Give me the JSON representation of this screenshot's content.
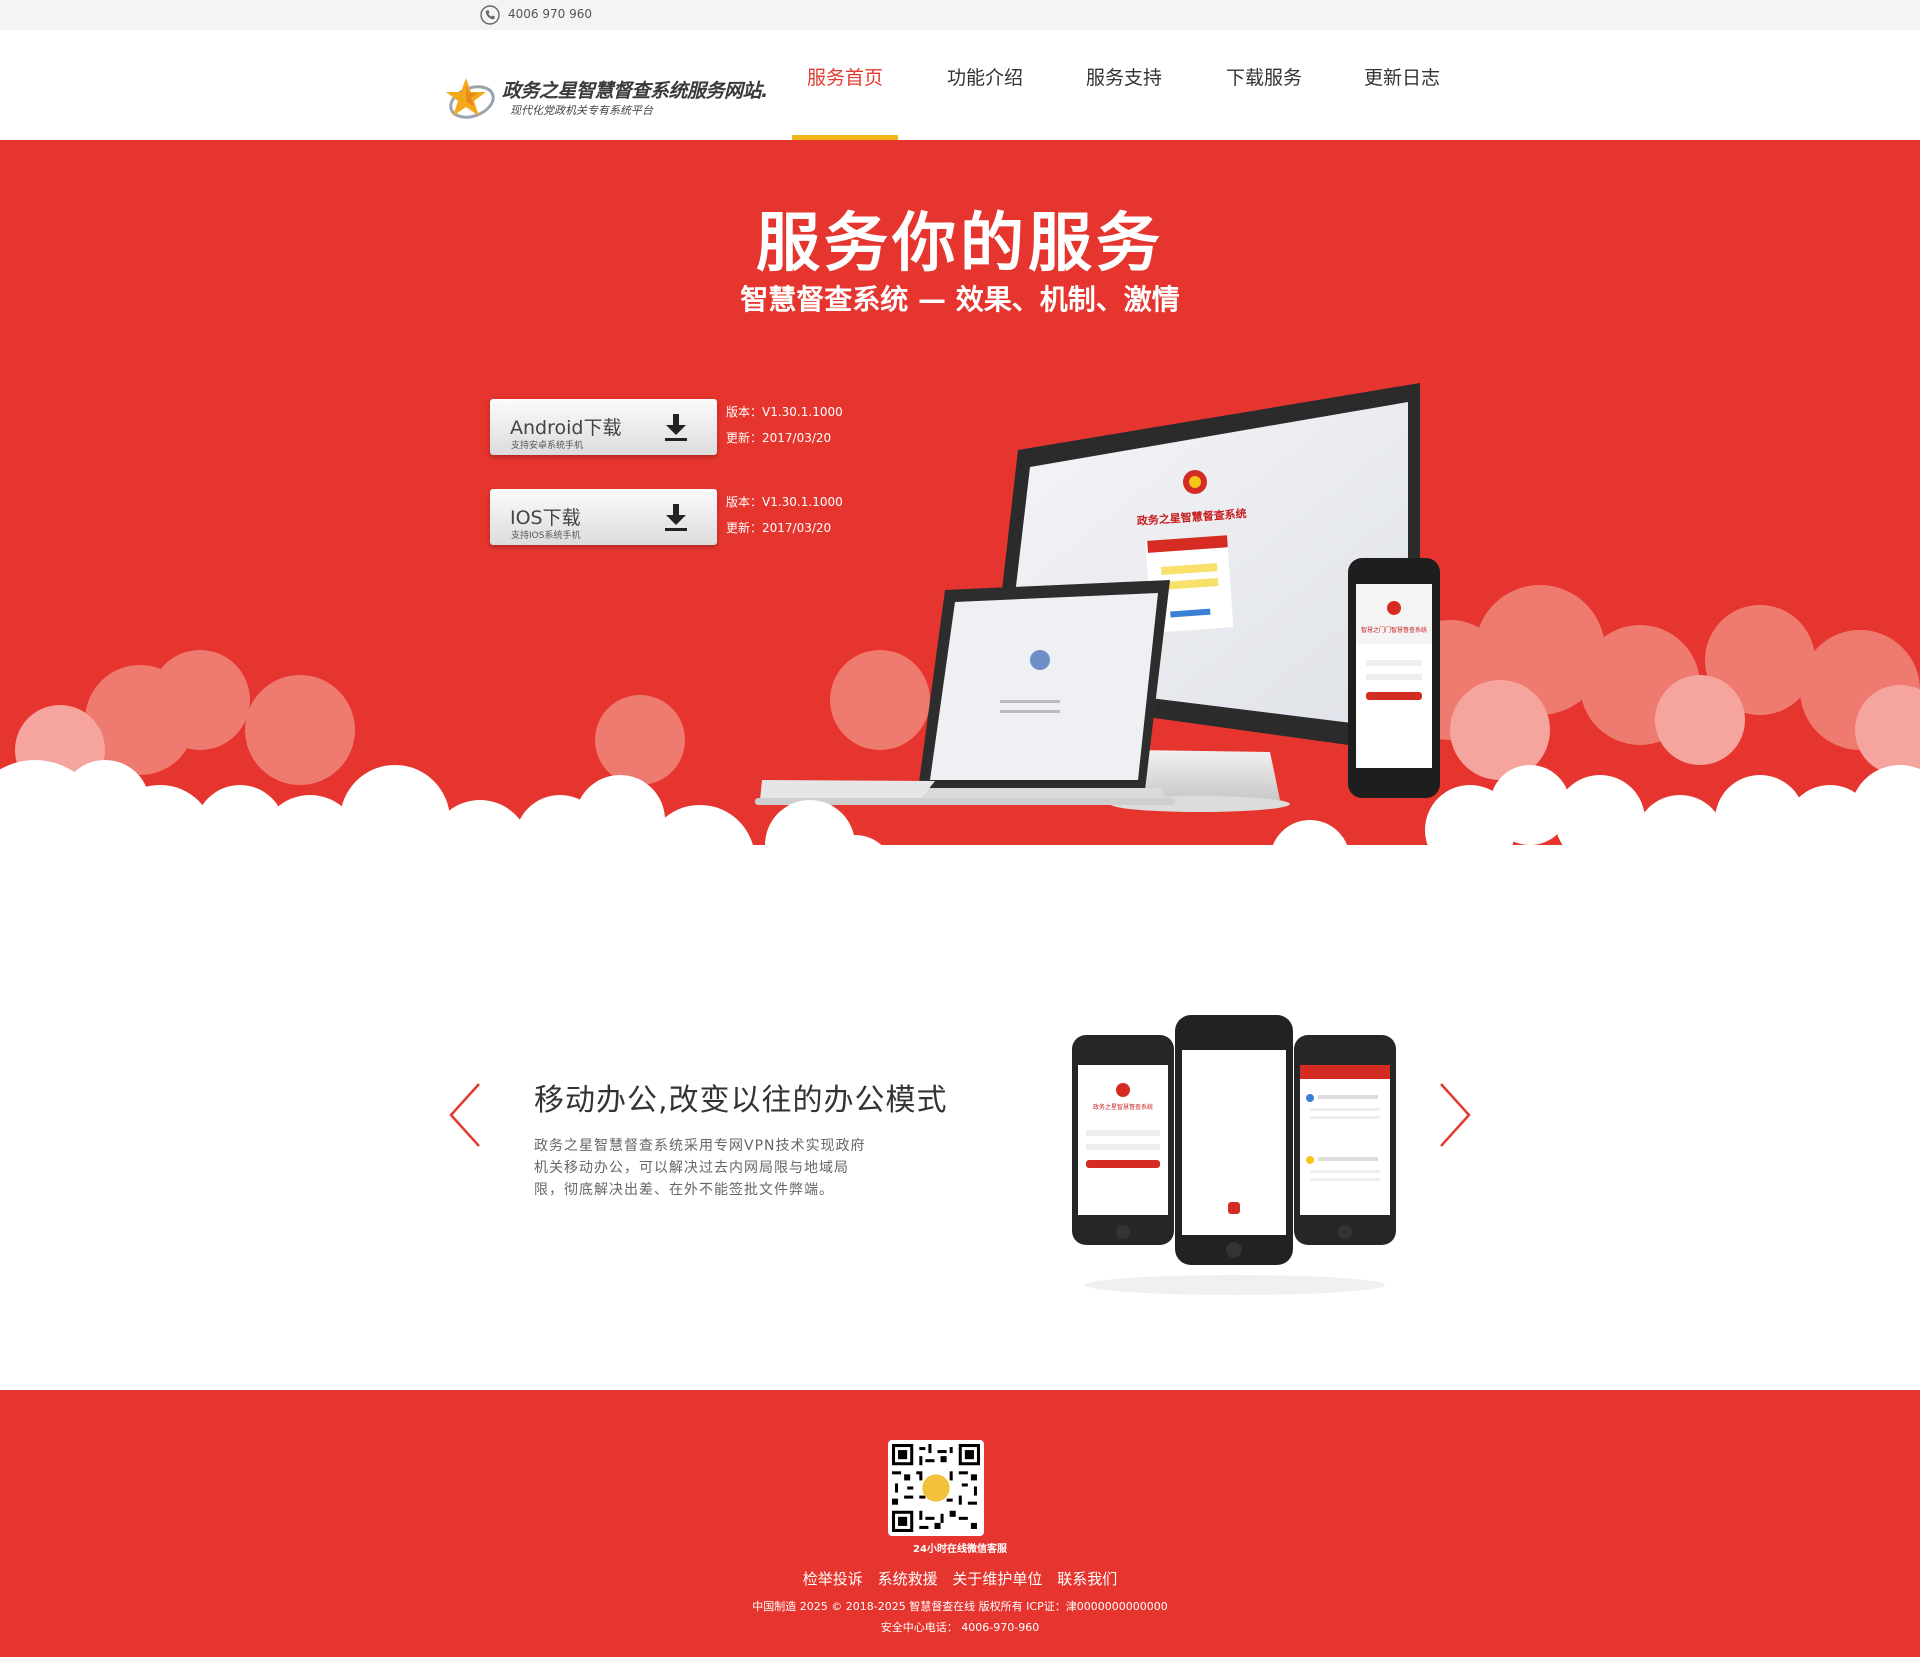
{
  "topbar": {
    "phone_icon": "phone-icon",
    "phone": "4006 970 960"
  },
  "logo": {
    "title": "政务之星智慧督查系统服务网站.",
    "subtitle": "现代化党政机关专有系统平台"
  },
  "nav": {
    "items": [
      {
        "label": "服务首页",
        "active": true
      },
      {
        "label": "功能介绍",
        "active": false
      },
      {
        "label": "服务支持",
        "active": false
      },
      {
        "label": "下载服务",
        "active": false
      },
      {
        "label": "更新日志",
        "active": false
      }
    ],
    "active_color": "#e33a2f",
    "underline_color": "#f2b51a"
  },
  "hero": {
    "title": "服务你的服务",
    "subtitle": "智慧督查系统 — 效果、机制、激情",
    "background": "#e5352e",
    "downloads": [
      {
        "label": "Android下载",
        "note": "支持安卓系统手机",
        "version": "版本：V1.30.1.1000",
        "updated": "更新：2017/03/20",
        "icon": "download-icon"
      },
      {
        "label": "IOS下载",
        "note": "支持IOS系统手机",
        "version": "版本：V1.30.1.1000",
        "updated": "更新：2017/03/20",
        "icon": "download-icon"
      }
    ],
    "monitor_screen": {
      "title": "政务之星智慧督查系统"
    },
    "phone_screen": {
      "title": "智慧之门门智慧督查系统"
    }
  },
  "feature": {
    "title": "移动办公,改变以往的办公模式",
    "description": "政务之星智慧督查系统采用专网VPN技术实现政府机关移动办公，可以解决过去内网局限与地域局限，彻底解决出差、在外不能签批文件弊端。",
    "phone_screen_title": "政务之星智慧督查系统",
    "prev_icon": "chevron-left-icon",
    "next_icon": "chevron-right-icon"
  },
  "footer": {
    "qr_caption": "24小时在线微信客服",
    "links": [
      "检举投诉",
      "系统救援",
      "关于维护单位",
      "联系我们"
    ],
    "copyright": "中国制造 2025  © 2018-2025 智慧督查在线  版权所有 ICP证：津0000000000000",
    "hotline": "安全中心电话：  4006-970-960"
  }
}
